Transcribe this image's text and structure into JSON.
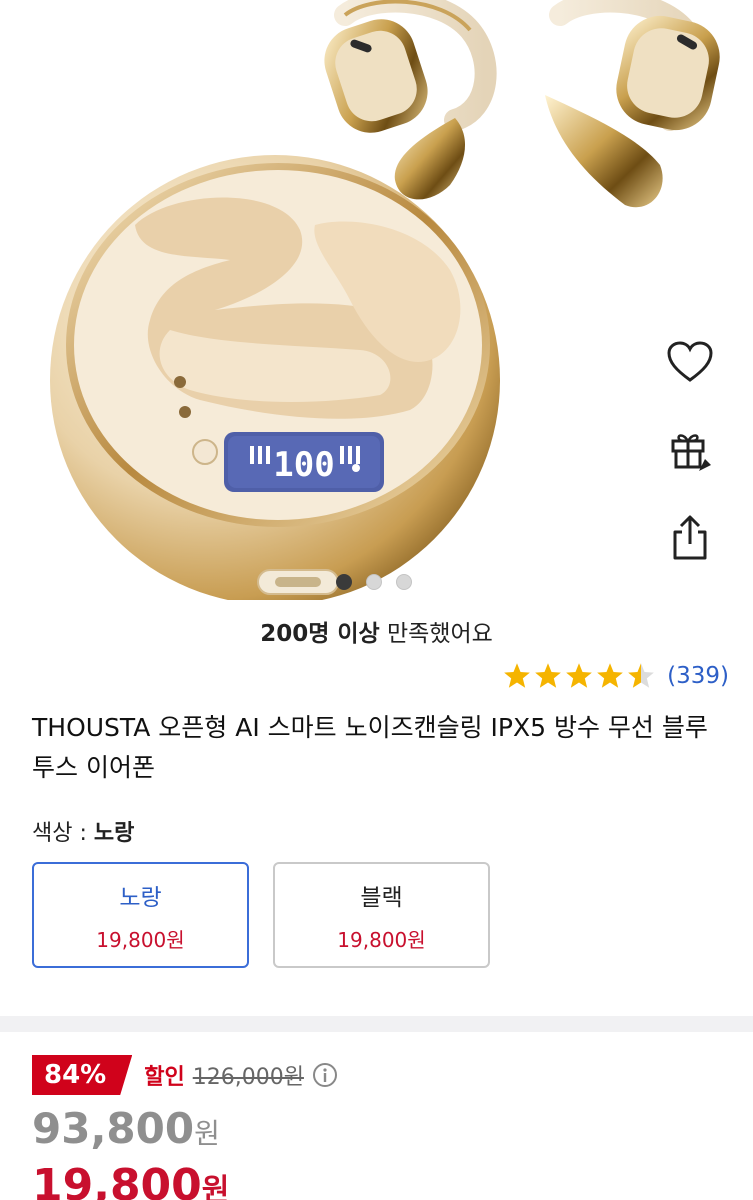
{
  "gallery": {
    "image_count": 3,
    "active_index": 0,
    "case_display": "100"
  },
  "side_actions": {
    "icons": [
      "heart-icon",
      "gift-icon",
      "share-icon"
    ]
  },
  "satisfaction": {
    "bold": "200명 이상",
    "rest": " 만족했어요"
  },
  "rating": {
    "stars": 4.5,
    "count": "(339)",
    "star_color": "#f5b400"
  },
  "product": {
    "title": "THOUSTA 오픈형 AI 스마트 노이즈캔슬링 IPX5 방수 무선 블루투스 이어폰"
  },
  "color": {
    "label": "색상 : ",
    "selected": "노랑",
    "options": [
      {
        "name": "노랑",
        "price": "19,800원",
        "selected": true
      },
      {
        "name": "블랙",
        "price": "19,800원",
        "selected": false
      }
    ]
  },
  "pricing": {
    "discount": "84%",
    "discount_label": "할인",
    "original": "126,000원",
    "member_price": "93,800",
    "member_unit": "원",
    "sale_price": "19,800",
    "sale_unit": "원",
    "accent_color": "#d0021b"
  }
}
